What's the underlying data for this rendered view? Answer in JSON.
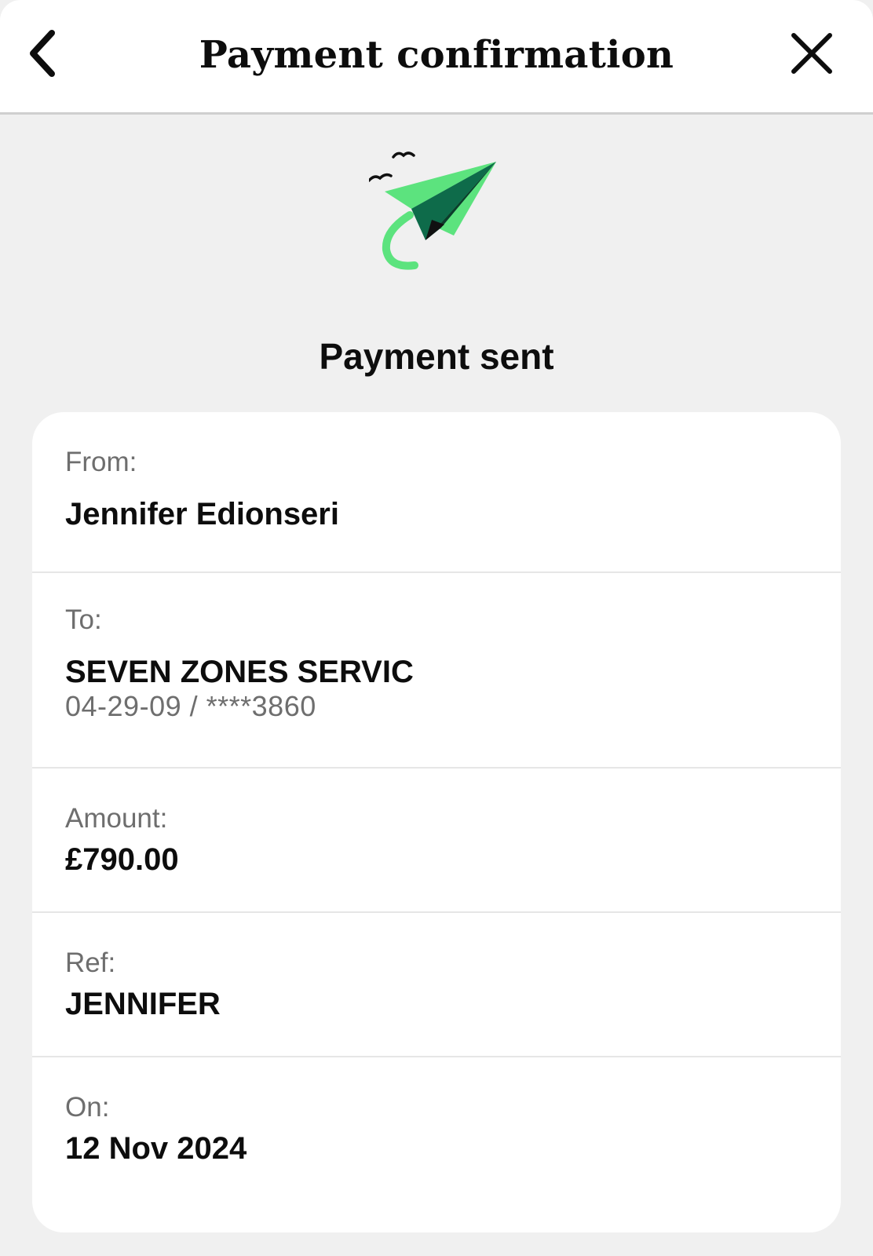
{
  "header": {
    "title": "Payment confirmation",
    "back_icon": "chevron-left-icon",
    "close_icon": "close-icon"
  },
  "illustration": {
    "icon": "paper-plane-icon",
    "colors": {
      "light_green": "#5ce37e",
      "dark_green": "#0e6b4a",
      "outline": "#111111"
    }
  },
  "status": {
    "heading": "Payment sent"
  },
  "details": {
    "from": {
      "label": "From:",
      "value": "Jennifer Edionseri"
    },
    "to": {
      "label": "To:",
      "value": "SEVEN ZONES SERVIC",
      "account": "04-29-09 / ****3860"
    },
    "amount": {
      "label": "Amount:",
      "value": "£790.00"
    },
    "ref": {
      "label": "Ref:",
      "value": "JENNIFER"
    },
    "on": {
      "label": "On:",
      "value": "12 Nov 2024"
    }
  }
}
